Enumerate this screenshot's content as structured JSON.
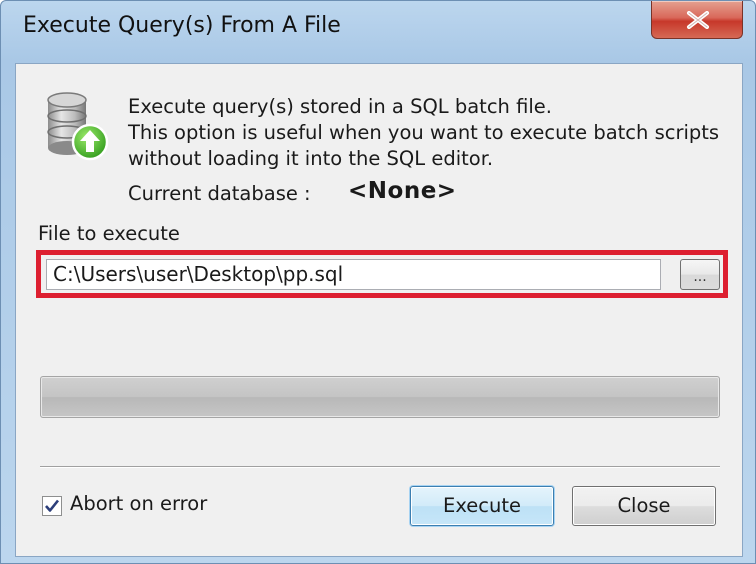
{
  "window": {
    "title": "Execute Query(s) From A File",
    "close_icon": "close-x-icon"
  },
  "info": {
    "icon": "database-upload-icon",
    "line1": "Execute query(s) stored in a SQL batch file.",
    "line2": "This option is useful when you want to execute batch scripts",
    "line3": "without loading it into the SQL editor.",
    "current_db_label": "Current database :",
    "current_db_value": "<None>"
  },
  "file": {
    "label": "File to execute",
    "value": "C:\\Users\\user\\Desktop\\pp.sql",
    "browse_label": "...",
    "highlight_color": "#dd1f30"
  },
  "progress": {
    "value": 0
  },
  "options": {
    "abort_on_error_label": "Abort on error",
    "abort_on_error_checked": true
  },
  "buttons": {
    "execute_label": "Execute",
    "close_label": "Close"
  }
}
